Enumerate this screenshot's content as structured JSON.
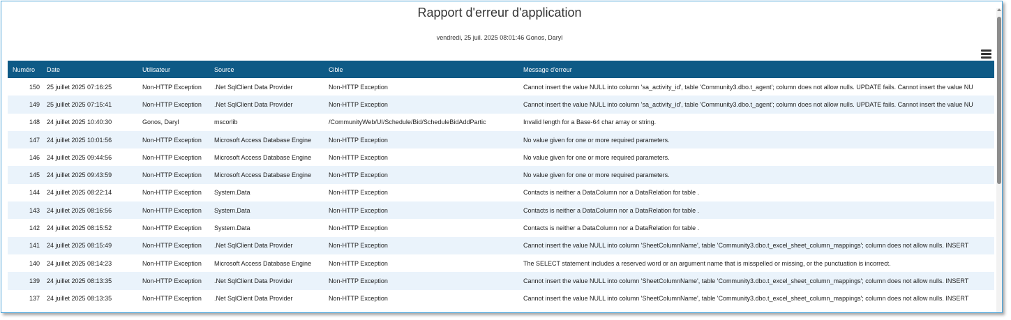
{
  "report": {
    "title": "Rapport d'erreur d'application",
    "subtitle": "vendredi, 25 juil. 2025 08:01:46  Gonos, Daryl"
  },
  "icons": {
    "menu": "hamburger-menu-icon"
  },
  "table": {
    "headers": [
      "Numéro",
      "Date",
      "Utilisateur",
      "Source",
      "Cible",
      "Message d'erreur"
    ],
    "rows": [
      [
        "150",
        "25 juillet 2025 07:16:25",
        "Non-HTTP Exception",
        ".Net SqlClient Data Provider",
        "Non-HTTP Exception",
        "Cannot insert the value NULL into column 'sa_activity_id', table 'Community3.dbo.t_agent'; column does not allow nulls. UPDATE fails. Cannot insert the value NU"
      ],
      [
        "149",
        "25 juillet 2025 07:15:41",
        "Non-HTTP Exception",
        ".Net SqlClient Data Provider",
        "Non-HTTP Exception",
        "Cannot insert the value NULL into column 'sa_activity_id', table 'Community3.dbo.t_agent'; column does not allow nulls. UPDATE fails. Cannot insert the value NU"
      ],
      [
        "148",
        "24 juillet 2025 10:40:30",
        "Gonos, Daryl",
        "mscorlib",
        "/CommunityWeb/UI/Schedule/Bid/ScheduleBidAddPartic",
        "Invalid length for a Base-64 char array or string."
      ],
      [
        "147",
        "24 juillet 2025 10:01:56",
        "Non-HTTP Exception",
        "Microsoft Access Database Engine",
        "Non-HTTP Exception",
        "No value given for one or more required parameters."
      ],
      [
        "146",
        "24 juillet 2025 09:44:56",
        "Non-HTTP Exception",
        "Microsoft Access Database Engine",
        "Non-HTTP Exception",
        "No value given for one or more required parameters."
      ],
      [
        "145",
        "24 juillet 2025 09:43:59",
        "Non-HTTP Exception",
        "Microsoft Access Database Engine",
        "Non-HTTP Exception",
        "No value given for one or more required parameters."
      ],
      [
        "144",
        "24 juillet 2025 08:22:14",
        "Non-HTTP Exception",
        "System.Data",
        "Non-HTTP Exception",
        "Contacts is neither a DataColumn nor a DataRelation for table ."
      ],
      [
        "143",
        "24 juillet 2025 08:16:56",
        "Non-HTTP Exception",
        "System.Data",
        "Non-HTTP Exception",
        "Contacts is neither a DataColumn nor a DataRelation for table ."
      ],
      [
        "142",
        "24 juillet 2025 08:15:52",
        "Non-HTTP Exception",
        "System.Data",
        "Non-HTTP Exception",
        "Contacts is neither a DataColumn nor a DataRelation for table ."
      ],
      [
        "141",
        "24 juillet 2025 08:15:49",
        "Non-HTTP Exception",
        ".Net SqlClient Data Provider",
        "Non-HTTP Exception",
        "Cannot insert the value NULL into column 'SheetColumnName', table 'Community3.dbo.t_excel_sheet_column_mappings'; column does not allow nulls. INSERT"
      ],
      [
        "140",
        "24 juillet 2025 08:14:23",
        "Non-HTTP Exception",
        "Microsoft Access Database Engine",
        "Non-HTTP Exception",
        "The SELECT statement includes a reserved word or an argument name that is misspelled or missing, or the punctuation is incorrect."
      ],
      [
        "139",
        "24 juillet 2025 08:13:35",
        "Non-HTTP Exception",
        ".Net SqlClient Data Provider",
        "Non-HTTP Exception",
        "Cannot insert the value NULL into column 'SheetColumnName', table 'Community3.dbo.t_excel_sheet_column_mappings'; column does not allow nulls. INSERT"
      ],
      [
        "137",
        "24 juillet 2025 08:13:35",
        "Non-HTTP Exception",
        ".Net SqlClient Data Provider",
        "Non-HTTP Exception",
        "Cannot insert the value NULL into column 'SheetColumnName', table 'Community3.dbo.t_excel_sheet_column_mappings'; column does not allow nulls. INSERT"
      ]
    ]
  },
  "colors": {
    "header_bg": "#0e5a86",
    "row_alt": "#eaf3fb",
    "frame_border": "#4aa3d8"
  }
}
